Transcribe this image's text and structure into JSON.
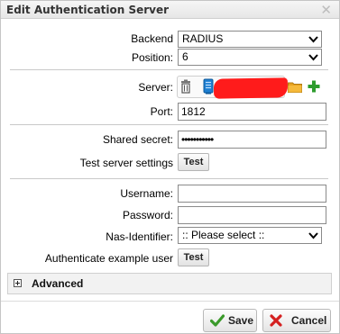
{
  "dialog": {
    "title": "Edit Authentication Server"
  },
  "form": {
    "backend": {
      "label": "Backend",
      "value": "RADIUS"
    },
    "position": {
      "label": "Position:",
      "value": "6"
    },
    "server": {
      "label": "Server:"
    },
    "port": {
      "label": "Port:",
      "value": "1812"
    },
    "shared_secret": {
      "label": "Shared secret:",
      "value": "•••••••••••"
    },
    "test_server": {
      "label": "Test server settings",
      "button": "Test"
    },
    "username": {
      "label": "Username:",
      "value": ""
    },
    "password": {
      "label": "Password:",
      "value": ""
    },
    "nas_identifier": {
      "label": "Nas-Identifier:",
      "value": ":: Please select ::"
    },
    "auth_example": {
      "label": "Authenticate example user",
      "button": "Test"
    }
  },
  "advanced": {
    "label": "Advanced"
  },
  "footer": {
    "save": "Save",
    "cancel": "Cancel"
  },
  "icons": {
    "close": "close-icon",
    "trash": "trash-icon",
    "server": "server-icon",
    "folder": "folder-icon",
    "add": "plus-icon",
    "expand": "expand-icon",
    "save": "checkmark-icon",
    "cancel": "x-icon"
  },
  "colors": {
    "add_green": "#2e9c2e",
    "save_green": "#3a9a2a",
    "cancel_red": "#d42020",
    "redaction": "#ff1b1b"
  }
}
